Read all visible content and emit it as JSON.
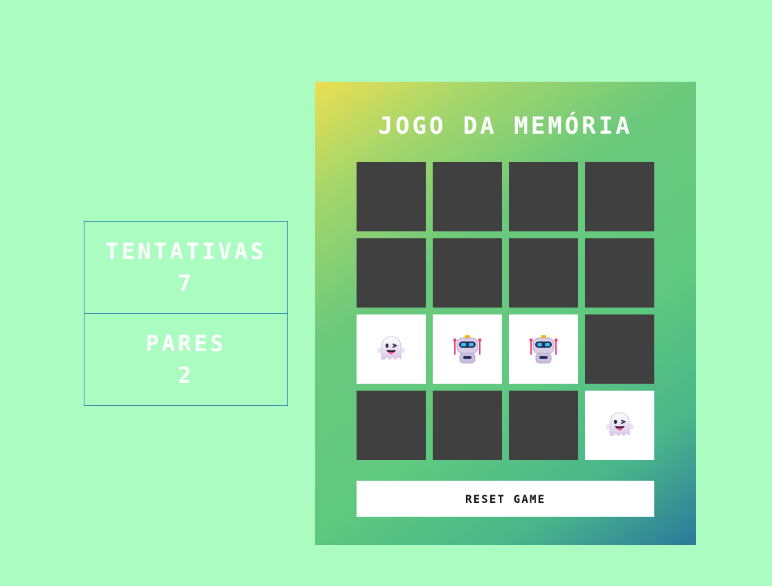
{
  "stats": {
    "attempts_label": "TENTATIVAS",
    "attempts_value": "7",
    "pairs_label": "PARES",
    "pairs_value": "2"
  },
  "game": {
    "title": "JOGO DA MEMÓRIA",
    "reset_label": "RESET GAME",
    "colors": {
      "card_back": "#404040",
      "card_face": "#ffffff",
      "page_bg": "#aafcc0"
    },
    "cards": [
      {
        "state": "hidden",
        "icon": null
      },
      {
        "state": "hidden",
        "icon": null
      },
      {
        "state": "hidden",
        "icon": null
      },
      {
        "state": "hidden",
        "icon": null
      },
      {
        "state": "hidden",
        "icon": null
      },
      {
        "state": "hidden",
        "icon": null
      },
      {
        "state": "hidden",
        "icon": null
      },
      {
        "state": "hidden",
        "icon": null
      },
      {
        "state": "revealed",
        "icon": "ghost-icon"
      },
      {
        "state": "revealed",
        "icon": "robot-icon"
      },
      {
        "state": "revealed",
        "icon": "robot-icon"
      },
      {
        "state": "hidden",
        "icon": null
      },
      {
        "state": "hidden",
        "icon": null
      },
      {
        "state": "hidden",
        "icon": null
      },
      {
        "state": "hidden",
        "icon": null
      },
      {
        "state": "revealed",
        "icon": "ghost-icon"
      }
    ]
  }
}
